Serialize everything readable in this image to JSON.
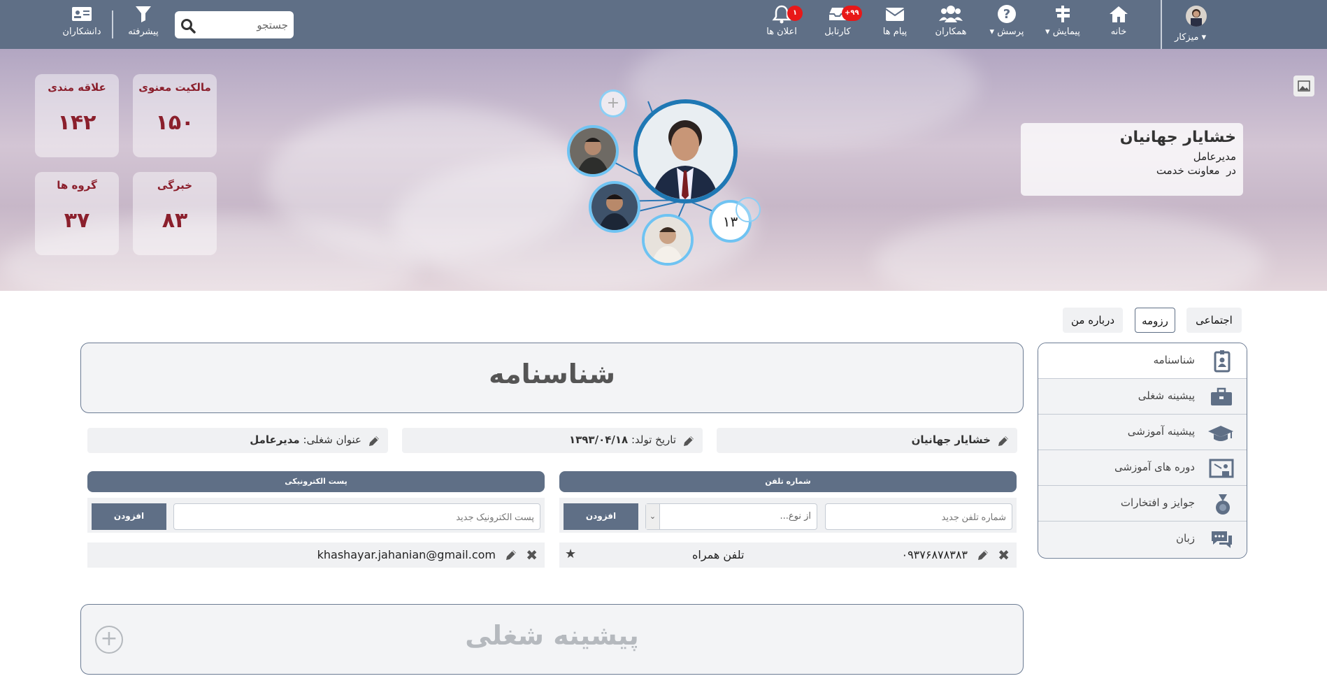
{
  "topbar": {
    "user_label": "میزکار",
    "nav": [
      {
        "id": "home",
        "label": "خانه",
        "icon": "home-icon"
      },
      {
        "id": "survey",
        "label": "پیمایش",
        "icon": "signpost-icon",
        "dropdown": true
      },
      {
        "id": "ask",
        "label": "پرسش",
        "icon": "question-icon",
        "dropdown": true
      },
      {
        "id": "colleagues",
        "label": "همکاران",
        "icon": "people-icon"
      },
      {
        "id": "messages",
        "label": "پیام ها",
        "icon": "envelope-icon"
      },
      {
        "id": "cartable",
        "label": "کارتابل",
        "icon": "inbox-icon",
        "badge": "+۹۹"
      },
      {
        "id": "notifications",
        "label": "اعلان ها",
        "icon": "bell-icon",
        "badge": "۱"
      }
    ],
    "search_placeholder": "جستجو",
    "advanced_label": "پیشرفته",
    "students_label": "دانشکاران"
  },
  "stats": [
    {
      "label": "مالکیت معنوی",
      "value": "۱۵۰"
    },
    {
      "label": "علاقه مندی",
      "value": "۱۴۲"
    },
    {
      "label": "خبرگی",
      "value": "۸۳"
    },
    {
      "label": "گروه ها",
      "value": "۳۷"
    }
  ],
  "profile": {
    "name": "خشایار جهانیان",
    "role": "مدیرعامل",
    "org_prefix": "در",
    "org": "معاونت خدمت",
    "network_count": "۱۳"
  },
  "tabs": [
    "اجتماعی",
    "رزومه",
    "درباره من"
  ],
  "sidemenu": [
    "شناسنامه",
    "پیشینه شغلی",
    "پیشینه آموزشی",
    "دوره های آموزشی",
    "جوایز و افتخارات",
    "زبان"
  ],
  "identity": {
    "title": "شناسنامه",
    "name": "خشایار جهانیان",
    "birth_label": "تاریخ تولد:",
    "birth_value": "۱۳۹۳/۰۴/۱۸",
    "job_label": "عنوان شغلی:",
    "job_value": "مدیرعامل",
    "phone_header": "شماره تلفن",
    "email_header": "پست الکترونیکی",
    "phone_placeholder": "شماره تلفن جدید",
    "type_placeholder": "از نوع...",
    "email_placeholder": "پست الکترونیک جدید",
    "add_label": "افزودن",
    "phone_value": "۰۹۳۷۶۸۷۸۳۸۳",
    "phone_type": "تلفن همراه",
    "email_value": "khashayar.jahanian@gmail.com"
  },
  "career_title": "پیشینه شغلی",
  "colors": {
    "topbar": "#5f6f86",
    "stat_text": "#8b1f2c",
    "bubble_border": "#6fc3f2",
    "main_bubble": "#1f78b4"
  }
}
